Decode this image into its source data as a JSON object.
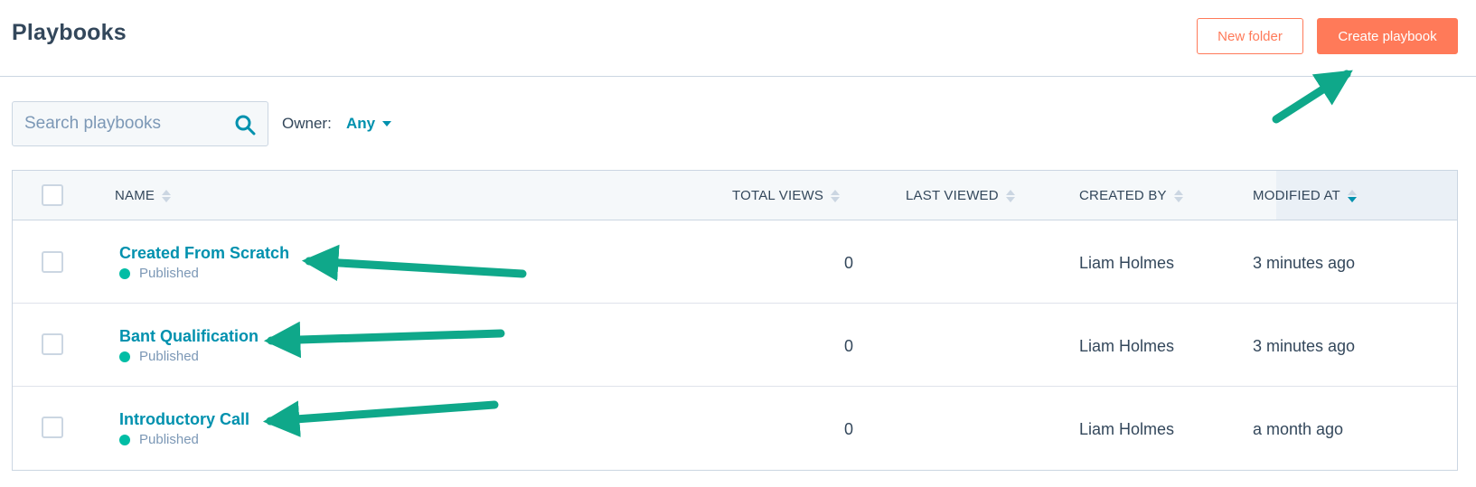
{
  "header": {
    "title": "Playbooks",
    "new_folder_label": "New folder",
    "create_playbook_label": "Create playbook"
  },
  "filters": {
    "search_placeholder": "Search playbooks",
    "search_value": "",
    "owner_label": "Owner:",
    "owner_value": "Any"
  },
  "table": {
    "columns": {
      "name": "NAME",
      "total_views": "TOTAL VIEWS",
      "last_viewed": "LAST VIEWED",
      "created_by": "CREATED BY",
      "modified_at": "MODIFIED AT"
    },
    "sorted_column": "modified_at",
    "sort_direction": "descending",
    "rows": [
      {
        "name": "Created From Scratch",
        "status": "Published",
        "total_views": "0",
        "last_viewed": "",
        "created_by": "Liam Holmes",
        "modified_at": "3 minutes ago"
      },
      {
        "name": "Bant Qualification",
        "status": "Published",
        "total_views": "0",
        "last_viewed": "",
        "created_by": "Liam Holmes",
        "modified_at": "3 minutes ago"
      },
      {
        "name": "Introductory Call",
        "status": "Published",
        "total_views": "0",
        "last_viewed": "",
        "created_by": "Liam Holmes",
        "modified_at": "a month ago"
      }
    ]
  },
  "colors": {
    "accent": "#ff7a59",
    "link": "#0091ae",
    "status_published": "#00bda5",
    "annotation_arrow": "#0fa88a",
    "text": "#33475b",
    "muted": "#7c98b6",
    "border": "#cbd6e2"
  },
  "icons": [
    "search-icon",
    "caret-down-icon",
    "sort-icon"
  ]
}
